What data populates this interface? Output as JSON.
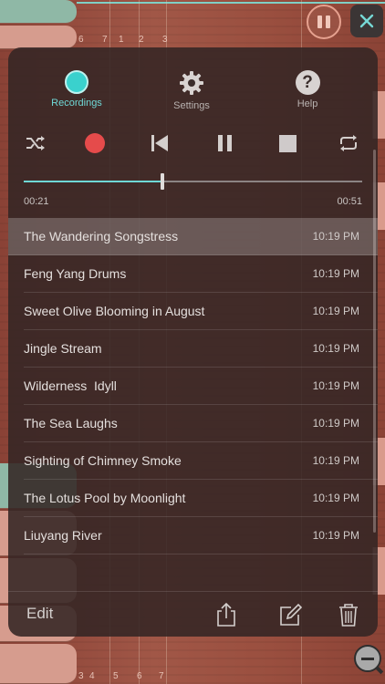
{
  "background": {
    "top_numbers": [
      "6",
      "7",
      "1",
      "2",
      "3"
    ],
    "bottom_numbers": [
      "3",
      "4",
      "5",
      "6",
      "7"
    ]
  },
  "tabs": [
    {
      "label": "Recordings",
      "icon": "record-circle-icon",
      "active": true
    },
    {
      "label": "Settings",
      "icon": "gear-icon",
      "active": false
    },
    {
      "label": "Help",
      "icon": "question-mark-icon",
      "active": false
    }
  ],
  "controls": {
    "shuffle": "shuffle-icon",
    "record": "record-icon",
    "previous": "skip-back-icon",
    "pause": "pause-icon",
    "stop": "stop-icon",
    "repeat": "repeat-icon"
  },
  "player": {
    "elapsed": "00:21",
    "total": "00:51",
    "progress_fraction": 0.41
  },
  "recordings": [
    {
      "title": "The Wandering Songstress",
      "time": "10:19 PM"
    },
    {
      "title": "Feng Yang Drums",
      "time": "10:19 PM"
    },
    {
      "title": "Sweet Olive Blooming in August",
      "time": "10:19 PM"
    },
    {
      "title": "Jingle Stream",
      "time": "10:19 PM"
    },
    {
      "title": "Wilderness  Idyll",
      "time": "10:19 PM"
    },
    {
      "title": "The Sea Laughs",
      "time": "10:19 PM"
    },
    {
      "title": "Sighting of Chimney Smoke",
      "time": "10:19 PM"
    },
    {
      "title": "The Lotus Pool by Moonlight",
      "time": "10:19 PM"
    },
    {
      "title": "Liuyang River",
      "time": "10:19 PM"
    }
  ],
  "bottom_bar": {
    "edit_label": "Edit",
    "share_icon": "share-icon",
    "compose_icon": "compose-icon",
    "trash_icon": "trash-icon"
  },
  "colors": {
    "accent": "#6fd8d6",
    "record": "#e54b4b",
    "panel": "#342624"
  }
}
